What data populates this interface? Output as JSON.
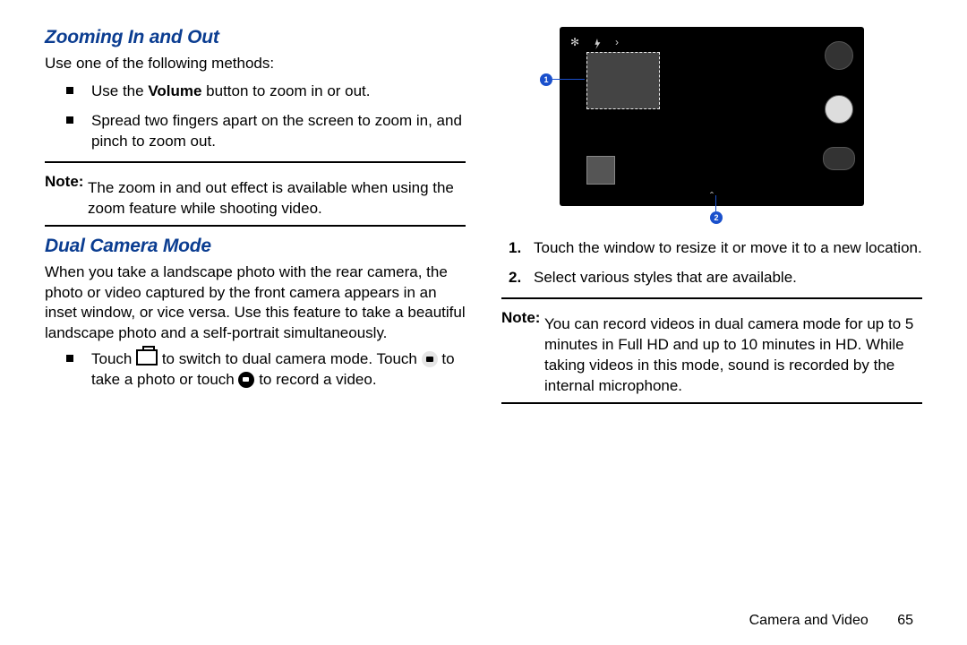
{
  "left": {
    "zoom": {
      "heading": "Zooming In and Out",
      "intro": "Use one of the following methods:",
      "bullets": [
        {
          "pre": "Use the ",
          "bold": "Volume",
          "post": " button to zoom in or out."
        },
        {
          "text": "Spread two fingers apart on the screen to zoom in, and pinch to zoom out."
        }
      ],
      "note_label": "Note:",
      "note": "The zoom in and out effect is available when using the zoom feature while shooting video."
    },
    "dual": {
      "heading": "Dual Camera Mode",
      "para": "When you take a landscape photo with the rear camera, the photo or video captured by the front camera appears in an inset window, or vice versa. Use this feature to take a beautiful landscape photo and a self-portrait simultaneously.",
      "touch_pre": "Touch ",
      "touch_mid": " to switch to dual camera mode. Touch ",
      "touch_post1": " to take a photo or touch ",
      "touch_post2": " to record a video."
    }
  },
  "right": {
    "callout1": "1",
    "callout2": "2",
    "steps": [
      "Touch the window to resize it or move it to a new location.",
      "Select various styles that are available."
    ],
    "note_label": "Note:",
    "note": "You can record videos in dual camera mode for up to 5 minutes in Full HD and up to 10 minutes in HD. While taking videos in this mode, sound is recorded by the internal microphone."
  },
  "footer": {
    "section": "Camera and Video",
    "page": "65"
  }
}
